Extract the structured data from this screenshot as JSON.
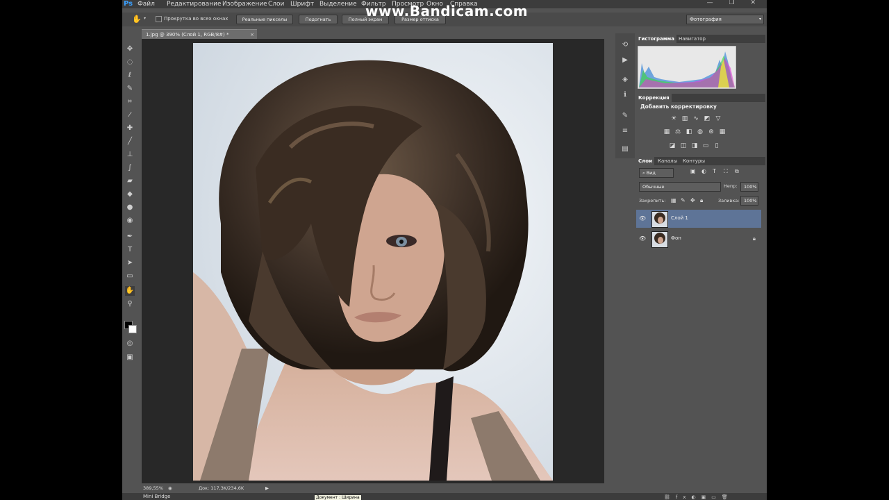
{
  "app": {
    "logo": "Ps"
  },
  "watermark": "www.Bandicam.com",
  "menu": [
    "Файл",
    "Редактирование",
    "Изображение",
    "Слои",
    "Шрифт",
    "Выделение",
    "Фильтр",
    "Просмотр",
    "Окно",
    "Справка"
  ],
  "window_buttons": "— ❐ ✕",
  "options": {
    "scroll_all_label": "Прокрутка во всех окнах",
    "buttons": [
      "Реальные пикселы",
      "Подогнать",
      "Полный экран",
      "Размер оттиска"
    ],
    "workspace": "Фотография"
  },
  "document": {
    "tab_title": "1.jpg @ 390% (Слой 1, RGB/8#) *",
    "zoom": "389,55%",
    "doc_size": "Док: 117,3K/234,6K"
  },
  "bottom": {
    "minibridge": "Mini Bridge",
    "tooltip": "Документ : Ширина"
  },
  "panels": {
    "histogram_tabs": [
      "Гистограмма",
      "Навигатор"
    ],
    "adjustments_tab": "Коррекция",
    "adjustments_title": "Добавить корректировку",
    "layers_tabs": [
      "Слои",
      "Каналы",
      "Контуры"
    ],
    "filter_kind": "Вид",
    "blend_mode": "Обычные",
    "opacity_label": "Непр:",
    "opacity_value": "100%",
    "lock_label": "Закрепить:",
    "fill_label": "Заливка:",
    "fill_value": "100%",
    "layers": [
      {
        "name": "Слой 1",
        "selected": true
      },
      {
        "name": "Фон",
        "selected": false
      }
    ]
  },
  "icons": {
    "tools": [
      "move-icon",
      "marquee-icon",
      "lasso-icon",
      "quick-select-icon",
      "crop-icon",
      "eyedropper-icon",
      "healing-icon",
      "brush-icon",
      "stamp-icon",
      "history-brush-icon",
      "eraser-icon",
      "gradient-icon",
      "blur-icon",
      "dodge-icon",
      "pen-icon",
      "type-icon",
      "path-select-icon",
      "shape-icon",
      "hand-icon",
      "zoom-icon"
    ]
  }
}
